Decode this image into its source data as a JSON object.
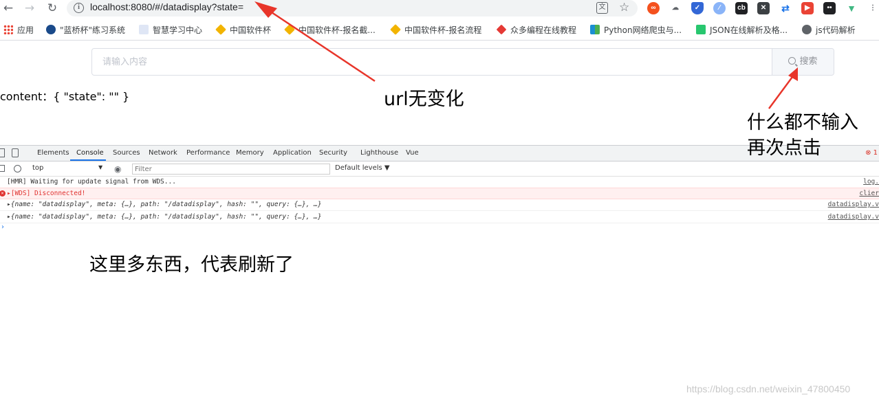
{
  "browser": {
    "url": "localhost:8080/#/datadisplay?state=",
    "bookmarks": [
      "应用",
      "\"蓝桥杯\"练习系统",
      "智慧学习中心",
      "中国软件杯",
      "中国软件杯-报名截...",
      "中国软件杯-报名流程",
      "众多编程在线教程",
      "Python网络爬虫与...",
      "JSON在线解析及格...",
      "js代码解析"
    ],
    "colors": {
      "accent": "#1a73e8",
      "error": "#e0312f"
    }
  },
  "page": {
    "search_placeholder": "请输入内容",
    "search_button": "搜索",
    "content_line": "content：{ \"state\": \"\" }"
  },
  "annotations": {
    "url_note": "url无变化",
    "click_note_line1": "什么都不输入",
    "click_note_line2": "再次点击",
    "refresh_note": "这里多东西，代表刷新了",
    "arrow_color": "#e8352a"
  },
  "devtools": {
    "tabs": [
      "Elements",
      "Console",
      "Sources",
      "Network",
      "Performance",
      "Memory",
      "Application",
      "Security",
      "Lighthouse",
      "Vue"
    ],
    "active_tab": "Console",
    "error_count": "1",
    "context": "top",
    "filter_placeholder": "Filter",
    "levels": "Default levels ▼",
    "logs": [
      {
        "text": "[HMR] Waiting for update signal from WDS...",
        "source": "log.",
        "type": "info"
      },
      {
        "text": "▸[WDS] Disconnected!",
        "source": "clier",
        "type": "error"
      },
      {
        "text": "▸{name: \"datadisplay\", meta: {…}, path: \"/datadisplay\", hash: \"\", query: {…}, …}",
        "source": "datadisplay.v",
        "type": "object"
      },
      {
        "text": "▸{name: \"datadisplay\", meta: {…}, path: \"/datadisplay\", hash: \"\", query: {…}, …}",
        "source": "datadisplay.v",
        "type": "object"
      }
    ]
  },
  "watermark": "https://blog.csdn.net/weixin_47800450"
}
